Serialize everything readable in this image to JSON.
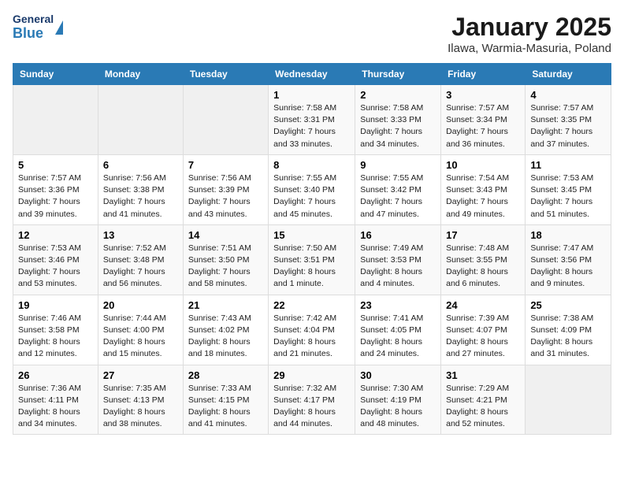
{
  "header": {
    "logo_line1": "General",
    "logo_line2": "Blue",
    "title": "January 2025",
    "subtitle": "Ilawa, Warmia-Masuria, Poland"
  },
  "calendar": {
    "headers": [
      "Sunday",
      "Monday",
      "Tuesday",
      "Wednesday",
      "Thursday",
      "Friday",
      "Saturday"
    ],
    "weeks": [
      {
        "days": [
          {
            "number": "",
            "info": ""
          },
          {
            "number": "",
            "info": ""
          },
          {
            "number": "",
            "info": ""
          },
          {
            "number": "1",
            "info": "Sunrise: 7:58 AM\nSunset: 3:31 PM\nDaylight: 7 hours\nand 33 minutes."
          },
          {
            "number": "2",
            "info": "Sunrise: 7:58 AM\nSunset: 3:33 PM\nDaylight: 7 hours\nand 34 minutes."
          },
          {
            "number": "3",
            "info": "Sunrise: 7:57 AM\nSunset: 3:34 PM\nDaylight: 7 hours\nand 36 minutes."
          },
          {
            "number": "4",
            "info": "Sunrise: 7:57 AM\nSunset: 3:35 PM\nDaylight: 7 hours\nand 37 minutes."
          }
        ]
      },
      {
        "days": [
          {
            "number": "5",
            "info": "Sunrise: 7:57 AM\nSunset: 3:36 PM\nDaylight: 7 hours\nand 39 minutes."
          },
          {
            "number": "6",
            "info": "Sunrise: 7:56 AM\nSunset: 3:38 PM\nDaylight: 7 hours\nand 41 minutes."
          },
          {
            "number": "7",
            "info": "Sunrise: 7:56 AM\nSunset: 3:39 PM\nDaylight: 7 hours\nand 43 minutes."
          },
          {
            "number": "8",
            "info": "Sunrise: 7:55 AM\nSunset: 3:40 PM\nDaylight: 7 hours\nand 45 minutes."
          },
          {
            "number": "9",
            "info": "Sunrise: 7:55 AM\nSunset: 3:42 PM\nDaylight: 7 hours\nand 47 minutes."
          },
          {
            "number": "10",
            "info": "Sunrise: 7:54 AM\nSunset: 3:43 PM\nDaylight: 7 hours\nand 49 minutes."
          },
          {
            "number": "11",
            "info": "Sunrise: 7:53 AM\nSunset: 3:45 PM\nDaylight: 7 hours\nand 51 minutes."
          }
        ]
      },
      {
        "days": [
          {
            "number": "12",
            "info": "Sunrise: 7:53 AM\nSunset: 3:46 PM\nDaylight: 7 hours\nand 53 minutes."
          },
          {
            "number": "13",
            "info": "Sunrise: 7:52 AM\nSunset: 3:48 PM\nDaylight: 7 hours\nand 56 minutes."
          },
          {
            "number": "14",
            "info": "Sunrise: 7:51 AM\nSunset: 3:50 PM\nDaylight: 7 hours\nand 58 minutes."
          },
          {
            "number": "15",
            "info": "Sunrise: 7:50 AM\nSunset: 3:51 PM\nDaylight: 8 hours\nand 1 minute."
          },
          {
            "number": "16",
            "info": "Sunrise: 7:49 AM\nSunset: 3:53 PM\nDaylight: 8 hours\nand 4 minutes."
          },
          {
            "number": "17",
            "info": "Sunrise: 7:48 AM\nSunset: 3:55 PM\nDaylight: 8 hours\nand 6 minutes."
          },
          {
            "number": "18",
            "info": "Sunrise: 7:47 AM\nSunset: 3:56 PM\nDaylight: 8 hours\nand 9 minutes."
          }
        ]
      },
      {
        "days": [
          {
            "number": "19",
            "info": "Sunrise: 7:46 AM\nSunset: 3:58 PM\nDaylight: 8 hours\nand 12 minutes."
          },
          {
            "number": "20",
            "info": "Sunrise: 7:44 AM\nSunset: 4:00 PM\nDaylight: 8 hours\nand 15 minutes."
          },
          {
            "number": "21",
            "info": "Sunrise: 7:43 AM\nSunset: 4:02 PM\nDaylight: 8 hours\nand 18 minutes."
          },
          {
            "number": "22",
            "info": "Sunrise: 7:42 AM\nSunset: 4:04 PM\nDaylight: 8 hours\nand 21 minutes."
          },
          {
            "number": "23",
            "info": "Sunrise: 7:41 AM\nSunset: 4:05 PM\nDaylight: 8 hours\nand 24 minutes."
          },
          {
            "number": "24",
            "info": "Sunrise: 7:39 AM\nSunset: 4:07 PM\nDaylight: 8 hours\nand 27 minutes."
          },
          {
            "number": "25",
            "info": "Sunrise: 7:38 AM\nSunset: 4:09 PM\nDaylight: 8 hours\nand 31 minutes."
          }
        ]
      },
      {
        "days": [
          {
            "number": "26",
            "info": "Sunrise: 7:36 AM\nSunset: 4:11 PM\nDaylight: 8 hours\nand 34 minutes."
          },
          {
            "number": "27",
            "info": "Sunrise: 7:35 AM\nSunset: 4:13 PM\nDaylight: 8 hours\nand 38 minutes."
          },
          {
            "number": "28",
            "info": "Sunrise: 7:33 AM\nSunset: 4:15 PM\nDaylight: 8 hours\nand 41 minutes."
          },
          {
            "number": "29",
            "info": "Sunrise: 7:32 AM\nSunset: 4:17 PM\nDaylight: 8 hours\nand 44 minutes."
          },
          {
            "number": "30",
            "info": "Sunrise: 7:30 AM\nSunset: 4:19 PM\nDaylight: 8 hours\nand 48 minutes."
          },
          {
            "number": "31",
            "info": "Sunrise: 7:29 AM\nSunset: 4:21 PM\nDaylight: 8 hours\nand 52 minutes."
          },
          {
            "number": "",
            "info": ""
          }
        ]
      }
    ]
  }
}
